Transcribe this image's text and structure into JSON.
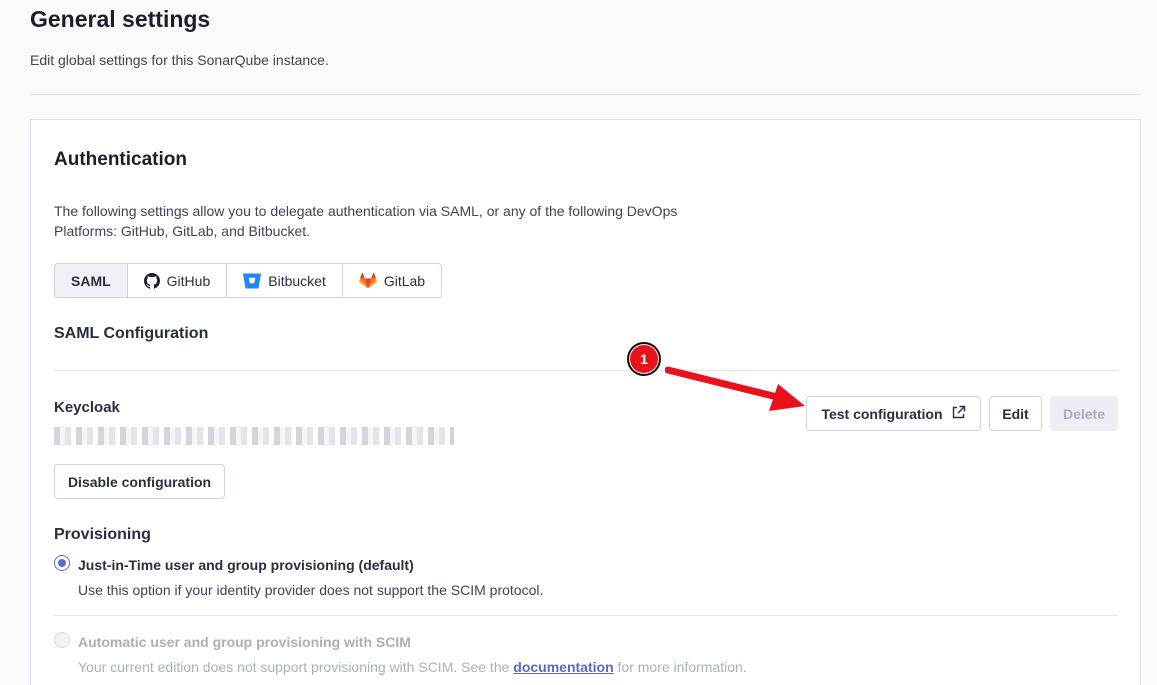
{
  "header": {
    "title": "General settings",
    "description": "Edit global settings for this SonarQube instance."
  },
  "auth": {
    "title": "Authentication",
    "description": "The following settings allow you to delegate authentication via SAML, or any of the following DevOps Platforms: GitHub, GitLab, and Bitbucket.",
    "tabs": [
      {
        "label": "SAML",
        "icon": "",
        "active": true
      },
      {
        "label": "GitHub",
        "icon": "github-icon",
        "active": false
      },
      {
        "label": "Bitbucket",
        "icon": "bitbucket-icon",
        "active": false
      },
      {
        "label": "GitLab",
        "icon": "gitlab-icon",
        "active": false
      }
    ]
  },
  "saml": {
    "section_title": "SAML Configuration",
    "config_name": "Keycloak",
    "test_button": "Test configuration",
    "test_button_icon": "external-link-icon",
    "edit_button": "Edit",
    "delete_button": "Delete",
    "disable_button": "Disable configuration"
  },
  "provisioning": {
    "title": "Provisioning",
    "option1": {
      "label": "Just-in-Time user and group provisioning (default)",
      "description": "Use this option if your identity provider does not support the SCIM protocol.",
      "selected": true
    },
    "option2": {
      "label": "Automatic user and group provisioning with SCIM",
      "description_before": "Your current edition does not support provisioning with SCIM. See the ",
      "link": "documentation",
      "description_after": " for more information.",
      "selected": false,
      "disabled": true
    }
  },
  "annotation": {
    "number": "1",
    "color": "#e8121a"
  },
  "colors": {
    "accent": "#5d6cd0",
    "link": "#5a68c6",
    "disabled_text": "#a9afbd",
    "bitbucket": "#2684ff",
    "gitlab": "#fc6d26"
  }
}
